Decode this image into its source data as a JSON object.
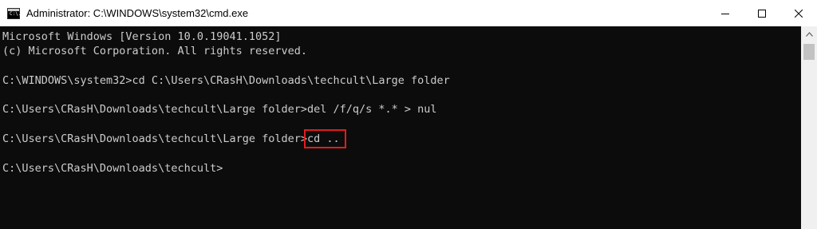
{
  "window": {
    "title": "Administrator: C:\\WINDOWS\\system32\\cmd.exe",
    "icon": "cmd-icon",
    "icon_text": "C:\\.",
    "buttons": [
      "minimize-icon",
      "maximize-icon",
      "close-icon"
    ]
  },
  "console": {
    "lines": [
      "Microsoft Windows [Version 10.0.19041.1052]",
      "(c) Microsoft Corporation. All rights reserved.",
      "",
      "C:\\WINDOWS\\system32>cd C:\\Users\\CRasH\\Downloads\\techcult\\Large folder",
      "",
      "C:\\Users\\CRasH\\Downloads\\techcult\\Large folder>del /f/q/s *.* > nul",
      "",
      "",
      "",
      "C:\\Users\\CRasH\\Downloads\\techcult>"
    ],
    "highlighted_line": {
      "prompt": "C:\\Users\\CRasH\\Downloads\\techcult\\Large folder>",
      "command": "cd .."
    }
  },
  "colors": {
    "console_bg": "#0c0c0c",
    "console_text": "#cccccc",
    "titlebar_bg": "#ffffff",
    "highlight_box": "#e11d1d",
    "scrollbar_bg": "#f0f0f0"
  }
}
